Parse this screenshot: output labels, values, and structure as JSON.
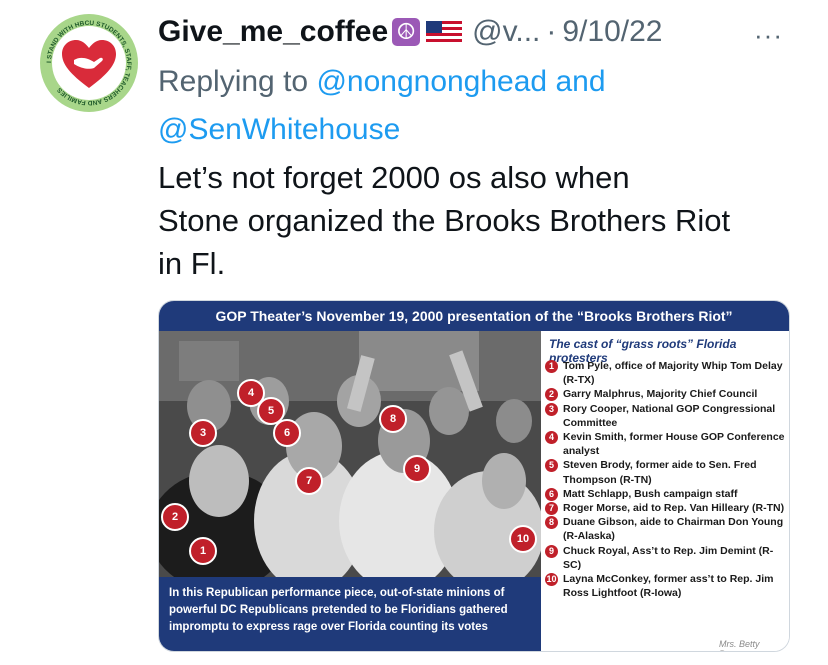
{
  "tweet": {
    "display_name": "Give_me_coffee",
    "handle": "@v...",
    "separator": "·",
    "date": "9/10/22",
    "more_label": "···",
    "replying_prefix": "Replying to",
    "reply_user_1": "@nongnonghead",
    "reply_and": "and",
    "reply_user_2": "@SenWhitehouse",
    "text_line_1": "Let’s not forget 2000 os also when",
    "text_line_2": "Stone organized the Brooks Brothers Riot",
    "text_line_3": "in Fl."
  },
  "avatar": {
    "ring_text": "I STAND WITH HBCU STUDENTS, STAFF, TEACHERS AND FAMILIES",
    "ring_color": "#a8d68a",
    "heart_color": "#d92b3a"
  },
  "media": {
    "banner_title": "GOP Theater’s November 19, 2000 presentation of the “Brooks Brothers Riot”",
    "cast_title": "The cast of “grass roots” Florida protesters",
    "cast": [
      {
        "num": "1",
        "text": "Tom Pyle, office of Majority Whip Tom Delay (R-TX)"
      },
      {
        "num": "2",
        "text": "Garry Malphrus, Majority Chief Council"
      },
      {
        "num": "3",
        "text": "Rory Cooper, National GOP Congressional Committee"
      },
      {
        "num": "4",
        "text": "Kevin Smith, former House GOP Conference analyst"
      },
      {
        "num": "5",
        "text": "Steven Brody, former aide to Sen. Fred Thompson (R-TN)"
      },
      {
        "num": "6",
        "text": "Matt Schlapp, Bush campaign staff"
      },
      {
        "num": "7",
        "text": "Roger Morse, aid to Rep. Van Hilleary (R-TN)"
      },
      {
        "num": "8",
        "text": "Duane Gibson, aide to Chairman Don Young (R-Alaska)"
      },
      {
        "num": "9",
        "text": "Chuck Royal, Ass’t to Rep. Jim Demint (R-SC)"
      },
      {
        "num": "10",
        "text": "Layna McConkey, former ass’t to Rep. Jim Ross Lightfoot (R-Iowa)"
      }
    ],
    "caption": "In this Republican performance piece, out-of-state minions of powerful DC Republicans pretended to be Floridians gathered impromptu to express rage over Florida counting its votes",
    "credit": "Mrs. Betty Bowers",
    "badge_labels": [
      "1",
      "2",
      "3",
      "4",
      "5",
      "6",
      "7",
      "8",
      "9",
      "10"
    ],
    "banner_color": "#1f3a7a",
    "badge_color": "#c0202a"
  }
}
